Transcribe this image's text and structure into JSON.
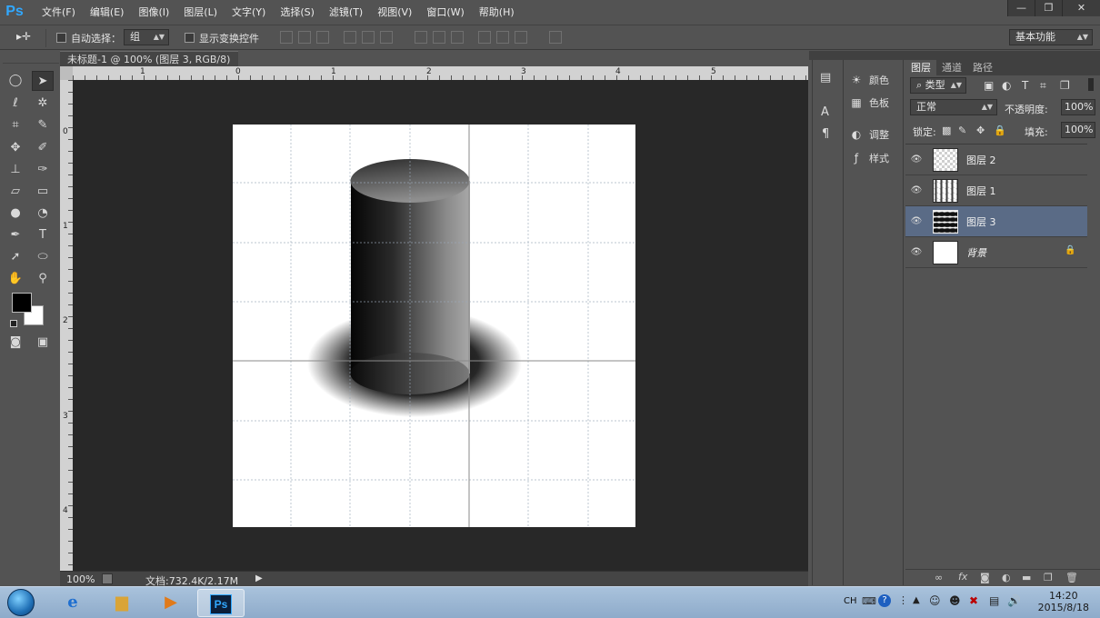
{
  "app": {
    "logo": "Ps"
  },
  "menu": [
    "文件(F)",
    "编辑(E)",
    "图像(I)",
    "图层(L)",
    "文字(Y)",
    "选择(S)",
    "滤镜(T)",
    "视图(V)",
    "窗口(W)",
    "帮助(H)"
  ],
  "window_controls": [
    "—",
    "❐",
    "✕"
  ],
  "options_bar": {
    "tool_glyph": "▸✛",
    "auto_select_label": "自动选择：",
    "auto_select_value": "组",
    "show_transform_label": "显示变换控件",
    "workspace_label": "基本功能"
  },
  "document": {
    "tab_label": "未标题-1 @ 100% (图层 3, RGB/8) *",
    "tab_close": "×",
    "ruler_h_numbers": [
      "1",
      "0",
      "1",
      "2",
      "3",
      "4",
      "5"
    ],
    "ruler_v_numbers": [
      "0",
      "1",
      "2",
      "3",
      "4"
    ]
  },
  "status": {
    "zoom": "100%",
    "doc_size": "文档:732.4K/2.17M",
    "arrow": "▶"
  },
  "mini_panels": [
    {
      "icon": "palette-icon",
      "label": "颜色"
    },
    {
      "icon": "swatches-icon",
      "label": "色板"
    },
    {
      "icon": "adjustments-icon",
      "label": "调整"
    },
    {
      "icon": "styles-icon",
      "label": "样式"
    }
  ],
  "layers_panel": {
    "tabs": [
      "图层",
      "通道",
      "路径"
    ],
    "filter_kind": "类型",
    "blend_mode": "正常",
    "opacity_label": "不透明度:",
    "opacity_value": "100%",
    "lock_label": "锁定:",
    "fill_label": "填充:",
    "fill_value": "100%",
    "layers": [
      {
        "name": "图层 2",
        "selected": false,
        "thumb": "checker"
      },
      {
        "name": "图层 1",
        "selected": false,
        "thumb": "cylinder"
      },
      {
        "name": "图层 3",
        "selected": true,
        "thumb": "shadow"
      },
      {
        "name": "背景",
        "selected": false,
        "thumb": "white",
        "locked": true
      }
    ]
  },
  "taskbar": {
    "apps": [
      "windows-start",
      "ie",
      "explorer",
      "media-player",
      "photoshop"
    ],
    "photoshop_label": "Ps",
    "tray_lang": "CH",
    "time": "14:20",
    "date": "2015/8/18"
  }
}
